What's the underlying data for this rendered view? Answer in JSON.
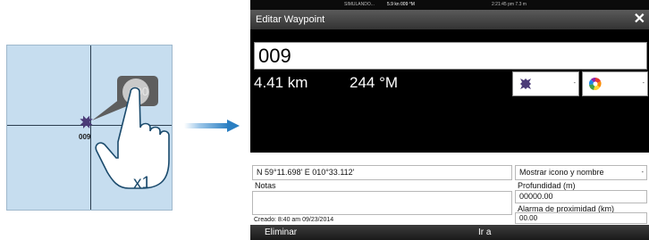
{
  "map": {
    "waypoint_label": "009",
    "bubble_label": "009",
    "tap_count": "x1"
  },
  "dialog": {
    "status": {
      "left": "SIMULANDO...",
      "mid": "5.9 kn 009 °M",
      "right": "2:21:45 pm  7.3 m"
    },
    "title": "Editar Waypoint",
    "close_glyph": "✕",
    "name": "009",
    "distance": "4.41 km",
    "bearing": "244 °M",
    "icon_dropdown_caret": "-",
    "color_dropdown_caret": "-",
    "coords": "N 59°11.698'  E 010°33.112'",
    "notes_label": "Notas",
    "notes_value": "",
    "show_mode": "Mostrar icono y nombre",
    "show_mode_caret": "-",
    "depth_label": "Profundidad (m)",
    "depth_value": "00000.00",
    "alarm_label": "Alarma de proximidad (km)",
    "alarm_value": "00.00",
    "created": "Creado: 8:40 am  09/23/2014",
    "delete_button": "Eliminar",
    "goto_button": "Ir a"
  },
  "colors": {
    "map_water": "#c6ddef",
    "arrow": "#2b7fc2",
    "title_bar": "#4a4a4a",
    "panel": "#000000"
  },
  "icons": [
    "waypoint-icon",
    "hand-pointer-icon",
    "arrow-right-icon",
    "close-icon",
    "color-wheel-icon"
  ]
}
